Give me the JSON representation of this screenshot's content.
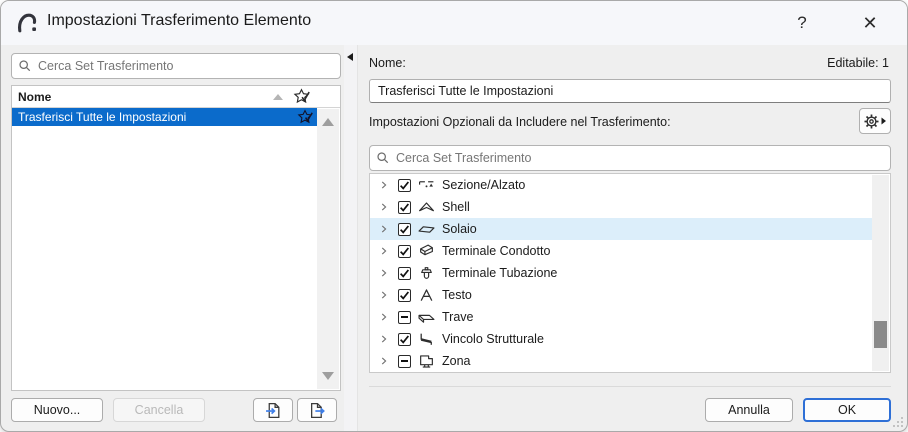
{
  "titlebar": {
    "title": "Impostazioni Trasferimento Elemento",
    "help": "?",
    "close": "✕"
  },
  "left": {
    "search_placeholder": "Cerca Set Trasferimento",
    "header": "Nome",
    "items": [
      {
        "label": "Trasferisci Tutte le Impostazioni",
        "selected": true,
        "favorite": true
      }
    ],
    "new_label": "Nuovo...",
    "delete_label": "Cancella"
  },
  "right": {
    "name_label": "Nome:",
    "editable": "Editabile: 1",
    "name_value": "Trasferisci Tutte le Impostazioni",
    "options_label": "Impostazioni Opzionali da Includere nel Trasferimento:",
    "search_placeholder": "Cerca Set Trasferimento",
    "tree": [
      {
        "label": "Sezione/Alzato",
        "state": "checked",
        "icon": "section-elevation-icon",
        "highlighted": false
      },
      {
        "label": "Shell",
        "state": "checked",
        "icon": "shell-icon",
        "highlighted": false
      },
      {
        "label": "Solaio",
        "state": "checked",
        "icon": "slab-icon",
        "highlighted": true
      },
      {
        "label": "Terminale Condotto",
        "state": "checked",
        "icon": "duct-terminal-icon",
        "highlighted": false
      },
      {
        "label": "Terminale Tubazione",
        "state": "checked",
        "icon": "pipe-terminal-icon",
        "highlighted": false
      },
      {
        "label": "Testo",
        "state": "checked",
        "icon": "text-icon",
        "highlighted": false
      },
      {
        "label": "Trave",
        "state": "mixed",
        "icon": "beam-icon",
        "highlighted": false
      },
      {
        "label": "Vincolo Strutturale",
        "state": "checked",
        "icon": "structural-support-icon",
        "highlighted": false
      },
      {
        "label": "Zona",
        "state": "mixed",
        "icon": "zone-icon",
        "highlighted": false
      }
    ],
    "cancel_label": "Annulla",
    "ok_label": "OK"
  },
  "colors": {
    "selection_blue": "#0b6bcb",
    "row_highlight": "#dceefa",
    "ok_border_blue": "#2e6fd6",
    "arrow_blue": "#3f7fe8",
    "dialog_bg": "#efefef",
    "titlebar_bg": "#f6f7fa"
  }
}
